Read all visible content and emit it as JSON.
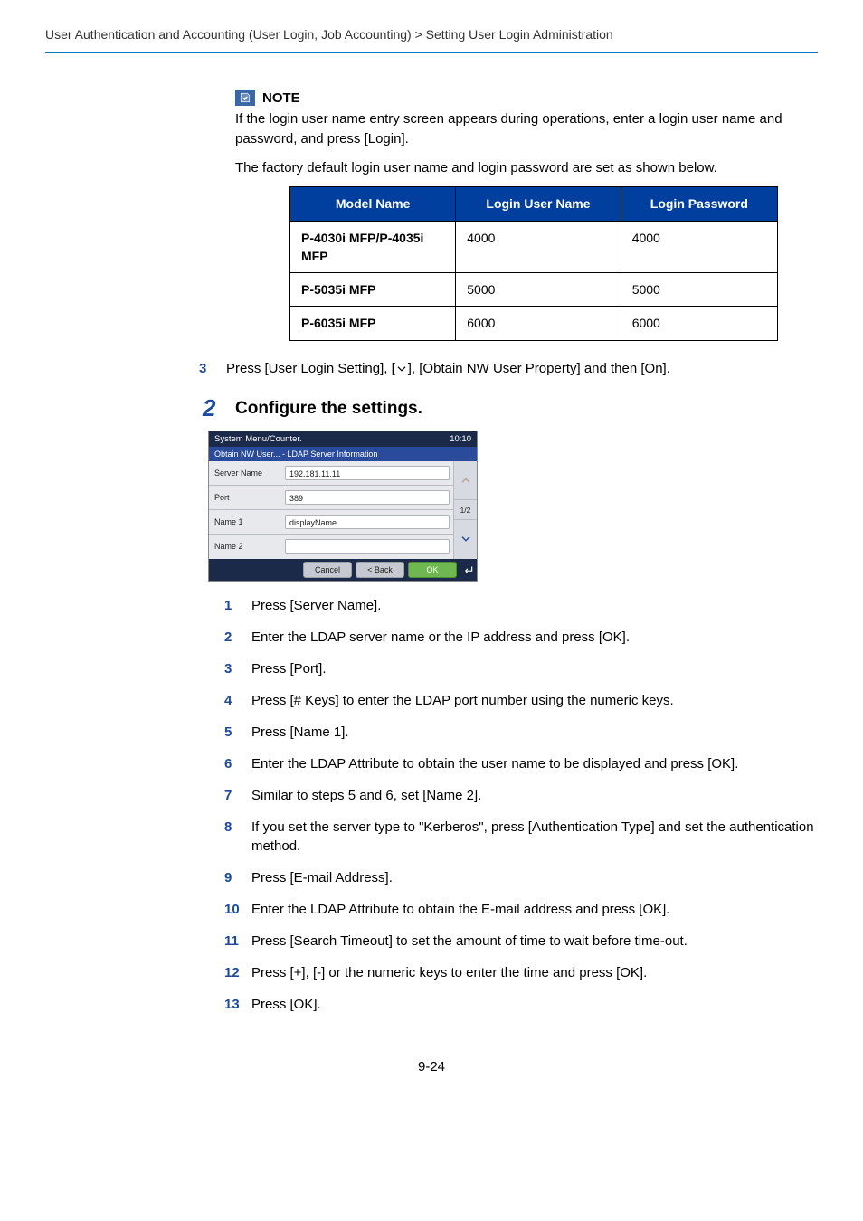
{
  "breadcrumb": "User Authentication and Accounting (User Login, Job Accounting) > Setting User Login Administration",
  "note": {
    "label": "NOTE",
    "p1": "If the login user name entry screen appears during operations, enter a login user name and password, and press [Login].",
    "p2": "The factory default login user name and login password are set as shown below."
  },
  "table": {
    "headers": {
      "model": "Model Name",
      "user": "Login User Name",
      "pass": "Login Password"
    },
    "rows": [
      {
        "model": "P-4030i MFP/P-4035i MFP",
        "user": "4000",
        "pass": "4000"
      },
      {
        "model": "P-5035i MFP",
        "user": "5000",
        "pass": "5000"
      },
      {
        "model": "P-6035i MFP",
        "user": "6000",
        "pass": "6000"
      }
    ]
  },
  "preStep": {
    "num": "3",
    "text_a": "Press [User Login Setting], [",
    "text_b": "], [Obtain NW User Property] and then [On]."
  },
  "section2": {
    "num": "2",
    "title": "Configure the settings."
  },
  "screen": {
    "title": "System Menu/Counter.",
    "time": "10:10",
    "subtitle": "Obtain NW User... - LDAP Server Information",
    "rows": [
      {
        "label": "Server Name",
        "value": "192.181.11.11"
      },
      {
        "label": "Port",
        "value": "389"
      },
      {
        "label": "Name 1",
        "value": "displayName"
      },
      {
        "label": "Name 2",
        "value": ""
      }
    ],
    "pager": "1/2",
    "cancel": "Cancel",
    "back": "< Back",
    "ok": "OK"
  },
  "steps": [
    {
      "n": "1",
      "t": "Press [Server Name]."
    },
    {
      "n": "2",
      "t": "Enter the LDAP server name or the IP address and press [OK]."
    },
    {
      "n": "3",
      "t": "Press [Port]."
    },
    {
      "n": "4",
      "t": "Press [# Keys] to enter the LDAP port number using the numeric keys."
    },
    {
      "n": "5",
      "t": "Press [Name 1]."
    },
    {
      "n": "6",
      "t": "Enter the LDAP Attribute to obtain the user name to be displayed and press [OK]."
    },
    {
      "n": "7",
      "t": "Similar to steps 5 and 6, set [Name 2]."
    },
    {
      "n": "8",
      "t": "If you set the server type to \"Kerberos\", press [Authentication Type] and set the authentication method."
    },
    {
      "n": "9",
      "t": "Press [E-mail Address]."
    },
    {
      "n": "10",
      "t": "Enter the LDAP Attribute to obtain the E-mail address and press [OK]."
    },
    {
      "n": "11",
      "t": "Press [Search Timeout] to set the amount of time to wait before time-out."
    },
    {
      "n": "12",
      "t": "Press [+], [-] or the numeric keys to enter the time and press [OK]."
    },
    {
      "n": "13",
      "t": "Press [OK]."
    }
  ],
  "pageNumber": "9-24"
}
